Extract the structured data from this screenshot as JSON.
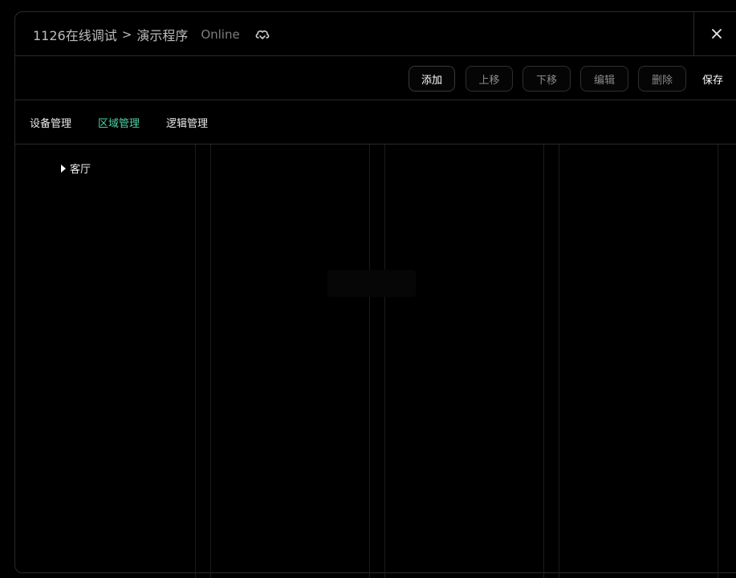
{
  "header": {
    "breadcrumb_project": "1126在线调试",
    "breadcrumb_separator": ">",
    "breadcrumb_program": "演示程序",
    "status": "Online",
    "cloud_icon": "cloud-sync-icon",
    "close_icon": "close-icon"
  },
  "toolbar": {
    "add_label": "添加",
    "move_up_label": "上移",
    "move_down_label": "下移",
    "edit_label": "编辑",
    "delete_label": "删除",
    "save_label": "保存"
  },
  "tabs": [
    {
      "label": "设备管理",
      "active": false
    },
    {
      "label": "区域管理",
      "active": true
    },
    {
      "label": "逻辑管理",
      "active": false
    }
  ],
  "tree": {
    "items": [
      {
        "label": "客厅",
        "icon": "caret-right-icon",
        "expanded": false
      }
    ]
  },
  "colors": {
    "background": "#000000",
    "active_tab": "#4fd1a5",
    "border": "#2a2a2a"
  }
}
